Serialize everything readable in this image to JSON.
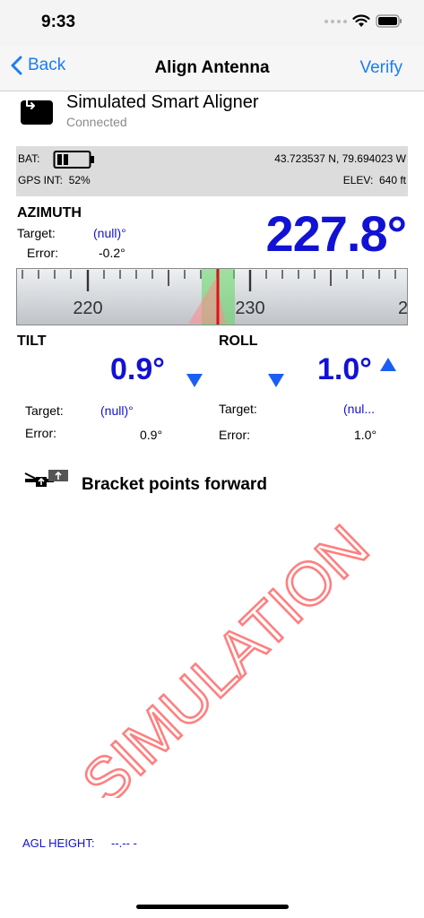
{
  "status_bar": {
    "time": "9:33"
  },
  "nav": {
    "back_label": "Back",
    "title": "Align Antenna",
    "verify_label": "Verify"
  },
  "device": {
    "name": "Simulated Smart Aligner",
    "status": "Connected"
  },
  "info": {
    "bat_label": "BAT:",
    "gps_label": "GPS INT:",
    "gps_value": "52%",
    "coords": "43.723537 N,  79.694023 W",
    "elev_label": "ELEV:",
    "elev_value": "640 ft"
  },
  "azimuth": {
    "label": "AZIMUTH",
    "target_label": "Target:",
    "target_value": "(null)°",
    "error_label": "Error:",
    "error_value": "-0.2°",
    "value": "227.8°",
    "scale_labels": [
      "220",
      "230",
      "2"
    ]
  },
  "tilt": {
    "label": "TILT",
    "value": "0.9°",
    "target_label": "Target:",
    "target_value": "(null)°",
    "error_label": "Error:",
    "error_value": "0.9°"
  },
  "roll": {
    "label": "ROLL",
    "value": "1.0°",
    "target_label": "Target:",
    "target_value": "(nul...",
    "error_label": "Error:",
    "error_value": "1.0°"
  },
  "bracket": {
    "text": "Bracket points forward"
  },
  "watermark": {
    "text": "SIMULATION"
  },
  "agl": {
    "label": "AGL HEIGHT:",
    "value": "--.-- -"
  },
  "colors": {
    "accent": "#1a7cf5",
    "value_blue": "#1212d4",
    "watermark_red": "#ff5a5a",
    "needle_red": "#e0101c",
    "band_green": "#6fdd6f"
  }
}
